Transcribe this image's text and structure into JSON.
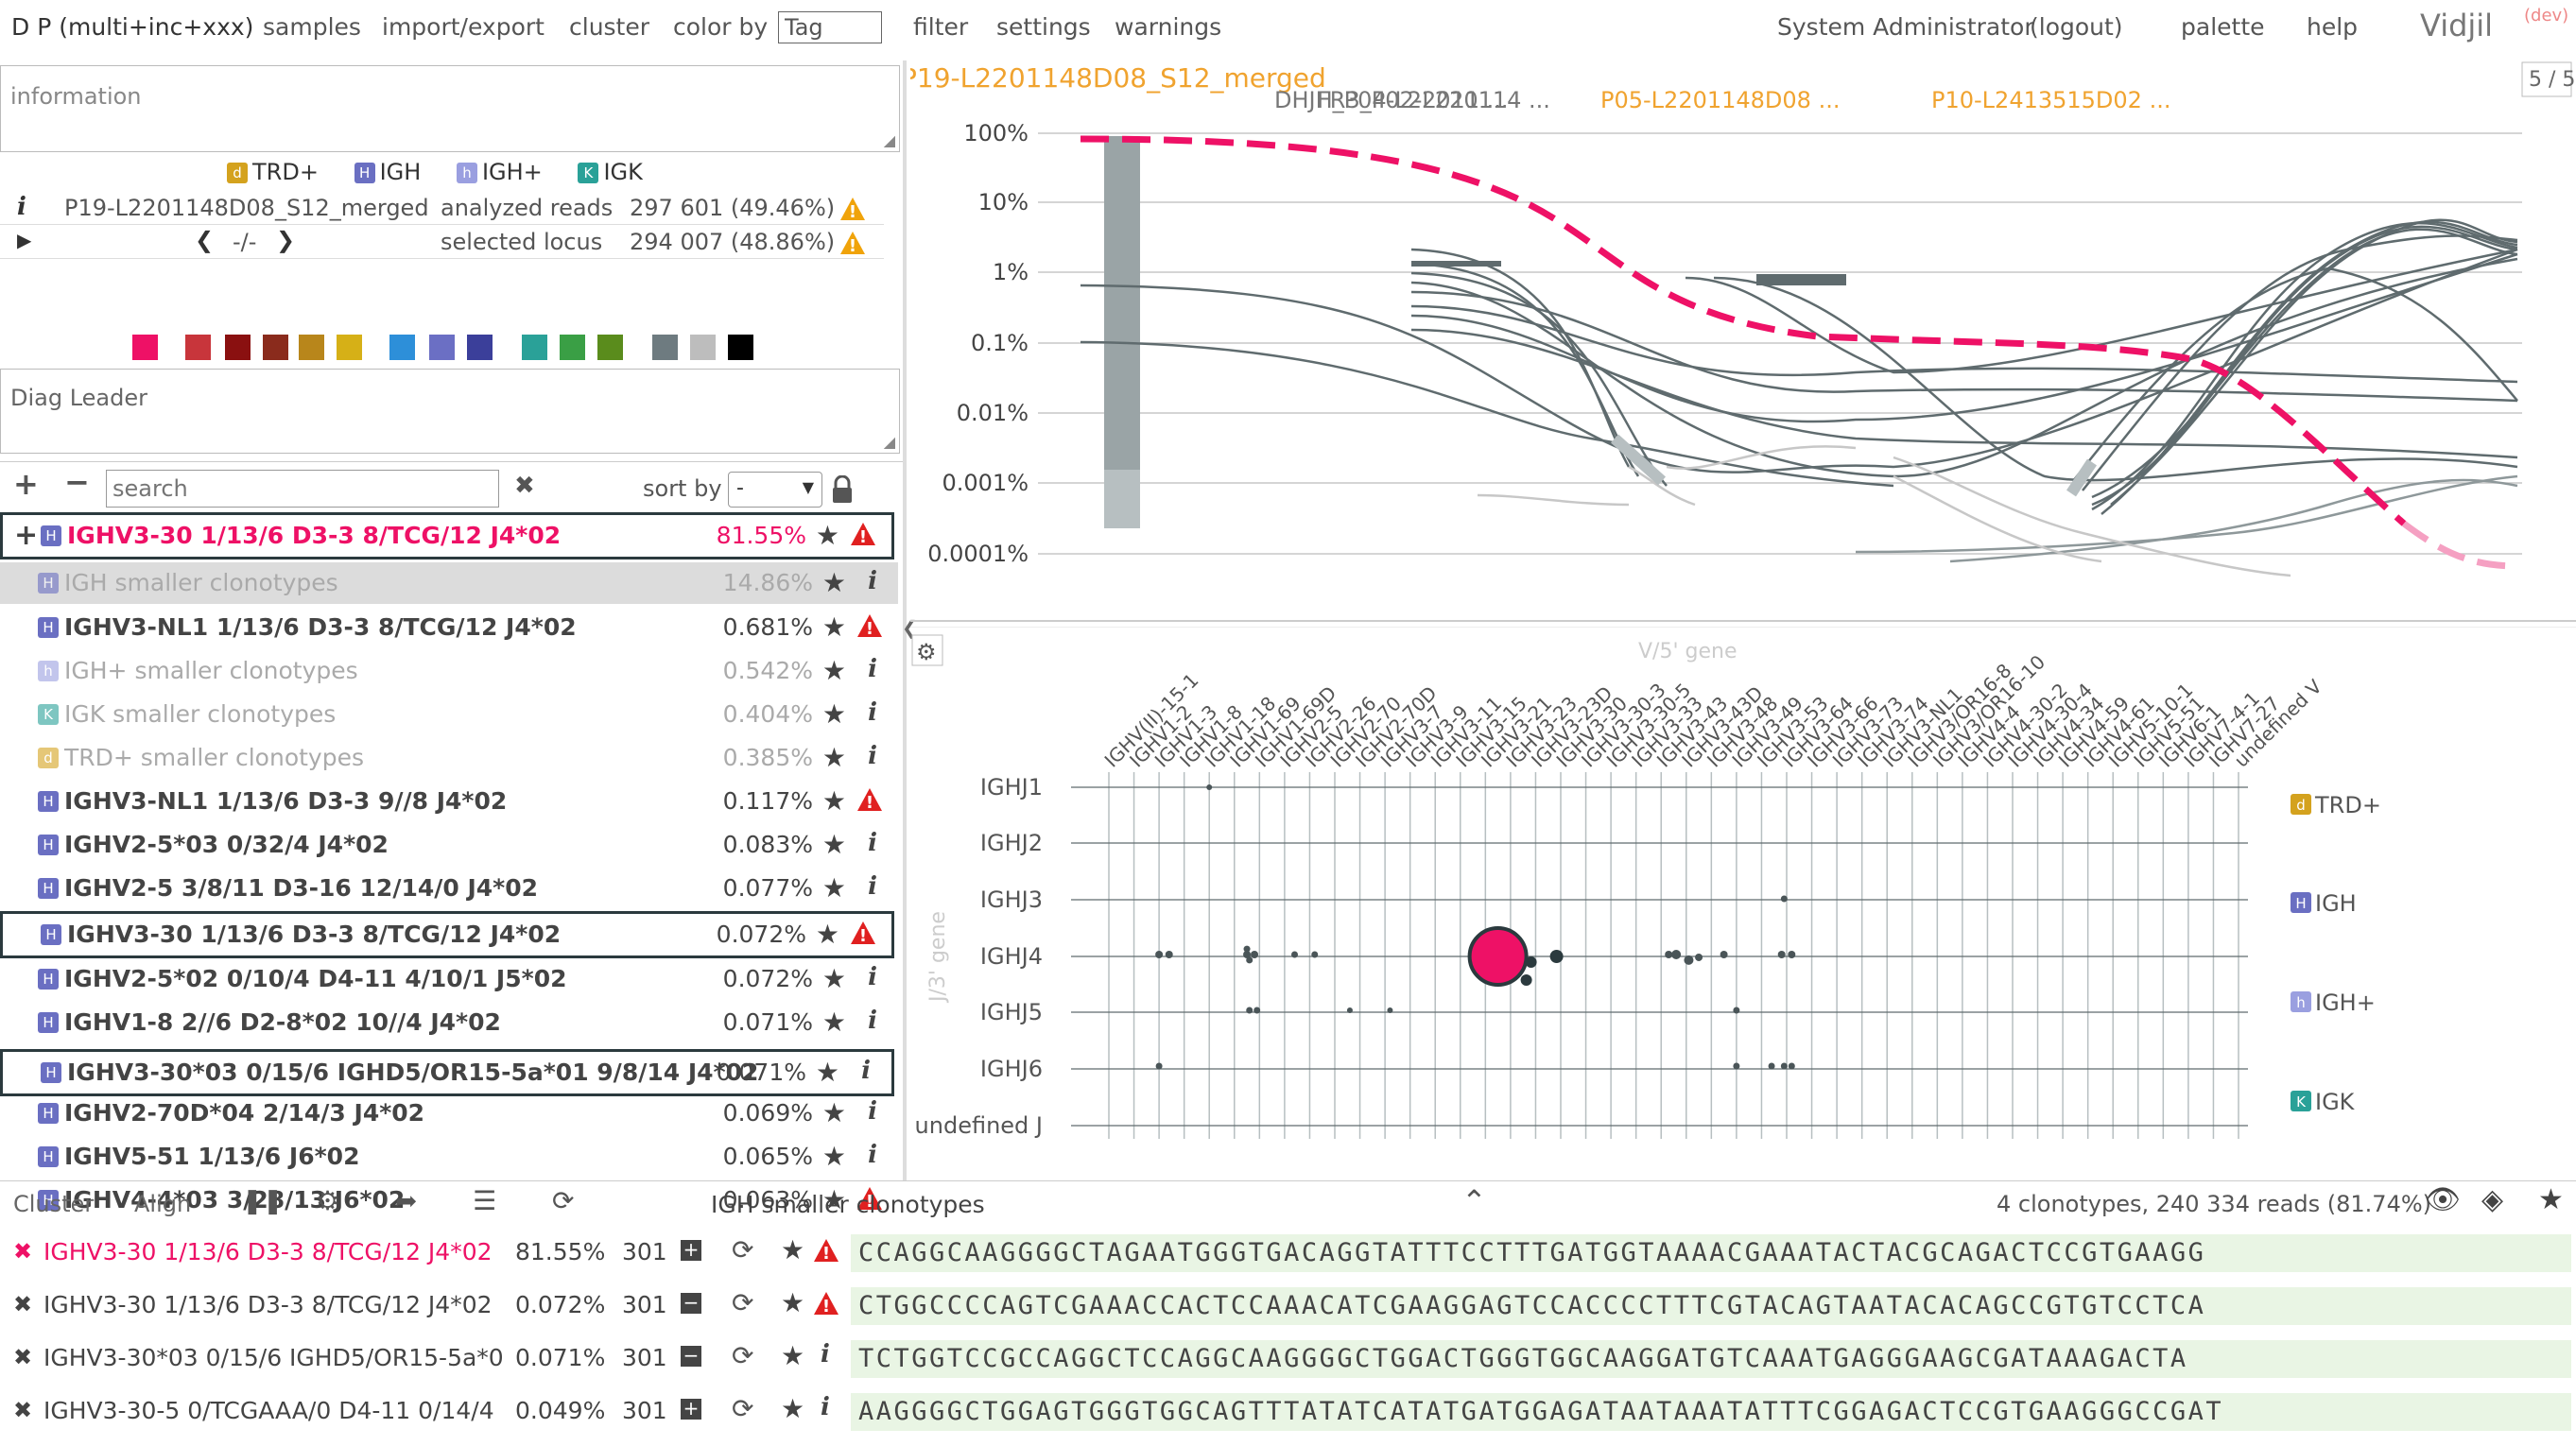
{
  "menu": {
    "dataset": "D P (multi+inc+xxx)",
    "samples": "samples",
    "import_export": "import/export",
    "cluster": "cluster",
    "color_by": "color by",
    "color_by_value": "Tag",
    "filter": "filter",
    "settings": "settings",
    "warnings": "warnings",
    "user": "System Administrator",
    "logout": "(logout)",
    "palette": "palette",
    "help": "help",
    "app_name": "Vidjil",
    "app_tag": "(dev)"
  },
  "info": {
    "placeholder": "information",
    "loci": [
      {
        "code": "d",
        "label": "TRD+",
        "color": "#d4a21e"
      },
      {
        "code": "H",
        "label": "IGH",
        "color": "#6a6fc2"
      },
      {
        "code": "h",
        "label": "IGH+",
        "color": "#9a9fe0"
      },
      {
        "code": "K",
        "label": "IGK",
        "color": "#2aa198"
      }
    ],
    "sample_name": "P19-L2201148D08_S12_merged",
    "analyzed_label": "analyzed reads",
    "analyzed_value": "297 601 (49.46%)",
    "selected_label": "selected locus",
    "selected_value": "294 007 (48.86%)",
    "nav_time": "-/-",
    "tag_colors": [
      "#ee1166",
      "#c8353b",
      "#8a1010",
      "#8a2b1c",
      "#b8861b",
      "#d6b017",
      "#2d8fd9",
      "#6b6fc4",
      "#3b3f9a",
      "#2aa198",
      "#3a9f45",
      "#5a8c1c",
      "#6e7b80",
      "#bdbdbd",
      "#000000"
    ]
  },
  "diag": {
    "placeholder": "Diag Leader"
  },
  "list_controls": {
    "search_placeholder": "search",
    "sort_label": "sort by",
    "sort_value": "-"
  },
  "clones": [
    {
      "name": "IGHV3-30 1/13/6 D3-3 8/TCG/12 J4*02",
      "pct": "81.55%",
      "badge": "H",
      "icon": "warn",
      "style": "top"
    },
    {
      "name": "IGH smaller clonotypes",
      "pct": "14.86%",
      "badge": "H",
      "icon": "info",
      "style": "smaller-selected"
    },
    {
      "name": "IGHV3-NL1 1/13/6 D3-3 8/TCG/12 J4*02",
      "pct": "0.681%",
      "badge": "H",
      "icon": "warn",
      "style": "normal"
    },
    {
      "name": "IGH+ smaller clonotypes",
      "pct": "0.542%",
      "badge": "h",
      "icon": "info",
      "style": "smaller"
    },
    {
      "name": "IGK smaller clonotypes",
      "pct": "0.404%",
      "badge": "K",
      "icon": "info",
      "style": "smaller"
    },
    {
      "name": "TRD+ smaller clonotypes",
      "pct": "0.385%",
      "badge": "d",
      "icon": "info",
      "style": "smaller"
    },
    {
      "name": "IGHV3-NL1 1/13/6 D3-3 9//8 J4*02",
      "pct": "0.117%",
      "badge": "H",
      "icon": "warn",
      "style": "normal"
    },
    {
      "name": "IGHV2-5*03 0/32/4 J4*02",
      "pct": "0.083%",
      "badge": "H",
      "icon": "info",
      "style": "normal"
    },
    {
      "name": "IGHV2-5 3/8/11 D3-16 12/14/0 J4*02",
      "pct": "0.077%",
      "badge": "H",
      "icon": "info",
      "style": "normal"
    },
    {
      "name": "IGHV3-30 1/13/6 D3-3 8/TCG/12 J4*02",
      "pct": "0.072%",
      "badge": "H",
      "icon": "warn",
      "style": "boxed"
    },
    {
      "name": "IGHV2-5*02 0/10/4 D4-11 4/10/1 J5*02",
      "pct": "0.072%",
      "badge": "H",
      "icon": "info",
      "style": "normal"
    },
    {
      "name": "IGHV1-8 2//6 D2-8*02 10//4 J4*02",
      "pct": "0.071%",
      "badge": "H",
      "icon": "info",
      "style": "normal"
    },
    {
      "name": "IGHV3-30*03 0/15/6 IGHD5/OR15-5a*01 9/8/14 J4*02",
      "pct": "0.071%",
      "badge": "H",
      "icon": "info",
      "style": "boxed"
    },
    {
      "name": "IGHV2-70D*04 2/14/3 J4*02",
      "pct": "0.069%",
      "badge": "H",
      "icon": "info",
      "style": "normal"
    },
    {
      "name": "IGHV5-51 1/13/6 J6*02",
      "pct": "0.065%",
      "badge": "H",
      "icon": "info",
      "style": "normal"
    },
    {
      "name": "IGHV4-4*03 3/28/13 J6*02",
      "pct": "0.063%",
      "badge": "H",
      "icon": "warn",
      "style": "normal"
    }
  ],
  "graph": {
    "title": "P19-L2201148D08_S12_merged",
    "page": "5 / 5",
    "samples": [
      "FR3_P02-L220114 ...",
      "DHJH_P04-L22011 ...",
      "P05-L2201148D08 ...",
      "P10-L2413515D02 ..."
    ],
    "y_ticks": [
      "100%",
      "10%",
      "1%",
      "0.1%",
      "0.01%",
      "0.001%",
      "0.0001%"
    ]
  },
  "plot": {
    "x_axis_label": "V/5' gene",
    "y_axis_label": "J/3' gene",
    "v_genes": [
      "IGHV(II)-15-1",
      "IGHV1-2",
      "IGHV1-3",
      "IGHV1-8",
      "IGHV1-18",
      "IGHV1-69",
      "IGHV1-69D",
      "IGHV2-5",
      "IGHV2-26",
      "IGHV2-70",
      "IGHV2-70D",
      "IGHV3-7",
      "IGHV3-9",
      "IGHV3-11",
      "IGHV3-15",
      "IGHV3-21",
      "IGHV3-23",
      "IGHV3-23D",
      "IGHV3-30",
      "IGHV3-30-3",
      "IGHV3-30-5",
      "IGHV3-33",
      "IGHV3-43",
      "IGHV3-43D",
      "IGHV3-48",
      "IGHV3-49",
      "IGHV3-53",
      "IGHV3-64",
      "IGHV3-66",
      "IGHV3-73",
      "IGHV3-74",
      "IGHV3-NL1",
      "IGHV3/OR16-8",
      "IGHV3/OR16-10",
      "IGHV4-4",
      "IGHV4-30-2",
      "IGHV4-30-4",
      "IGHV4-34",
      "IGHV4-59",
      "IGHV4-61",
      "IGHV5-10-1",
      "IGHV5-51",
      "IGHV6-1",
      "IGHV7-4-1",
      "IGHV7-27",
      "undefined V"
    ],
    "j_genes": [
      "IGHJ1",
      "IGHJ2",
      "IGHJ3",
      "IGHJ4",
      "IGHJ5",
      "IGHJ6",
      "undefined J"
    ],
    "legend": [
      {
        "code": "d",
        "label": "TRD+",
        "color": "#d4a21e"
      },
      {
        "code": "H",
        "label": "IGH",
        "color": "#6a6fc2"
      },
      {
        "code": "h",
        "label": "IGH+",
        "color": "#9a9fe0"
      },
      {
        "code": "K",
        "label": "IGK",
        "color": "#2aa198"
      }
    ]
  },
  "bottom": {
    "cluster_tab": "Cluster",
    "align_tab": "Align",
    "segment_title": "IGH smaller clonotypes",
    "summary": "4 clonotypes, 240 334 reads (81.74%)",
    "rows": [
      {
        "name": "IGHV3-30 1/13/6 D3-3 8/TCG/12 J4*02",
        "pct": "81.55%",
        "len": "301",
        "pm": "+",
        "icon": "warn",
        "highlight": true,
        "seq": "CCAGGCAAGGGGCTAGAATGGGTGACAGGTATTTCCTTTGATGGTAAAACGAAATACTACGCAGACTCCGTGAAGG"
      },
      {
        "name": "IGHV3-30 1/13/6 D3-3 8/TCG/12 J4*02",
        "pct": "0.072%",
        "len": "301",
        "pm": "−",
        "icon": "warn",
        "highlight": false,
        "seq": "CTGGCCCCAGTCGAAACCACTCCAAACATCGAAGGAGTCCACCCCTTTCGTACAGTAATACACAGCCGTGTCCTCA"
      },
      {
        "name": "IGHV3-30*03 0/15/6 IGHD5/OR15-5a*0",
        "pct": "0.071%",
        "len": "301",
        "pm": "−",
        "icon": "info",
        "highlight": false,
        "seq": "TCTGGTCCGCCAGGCTCCAGGCAAGGGGCTGGACTGGGTGGCAAGGATGTCAAATGAGGGAAGCGATAAAGACTA"
      },
      {
        "name": "IGHV3-30-5 0/TCGAAA/0 D4-11 0/14/4",
        "pct": "0.049%",
        "len": "301",
        "pm": "+",
        "icon": "info",
        "highlight": false,
        "seq": "AAGGGGCTGGAGTGGGTGGCAGTTTATATCATATGATGGAGATAATAAATATTTCGGAGACTCCGTGAAGGGCCGAT"
      }
    ]
  },
  "colors": {
    "accent": "#ee1166",
    "gray_line": "#5f6b6e",
    "light_line": "#c7c7c7",
    "sample_highlight": "#f0a32f"
  }
}
